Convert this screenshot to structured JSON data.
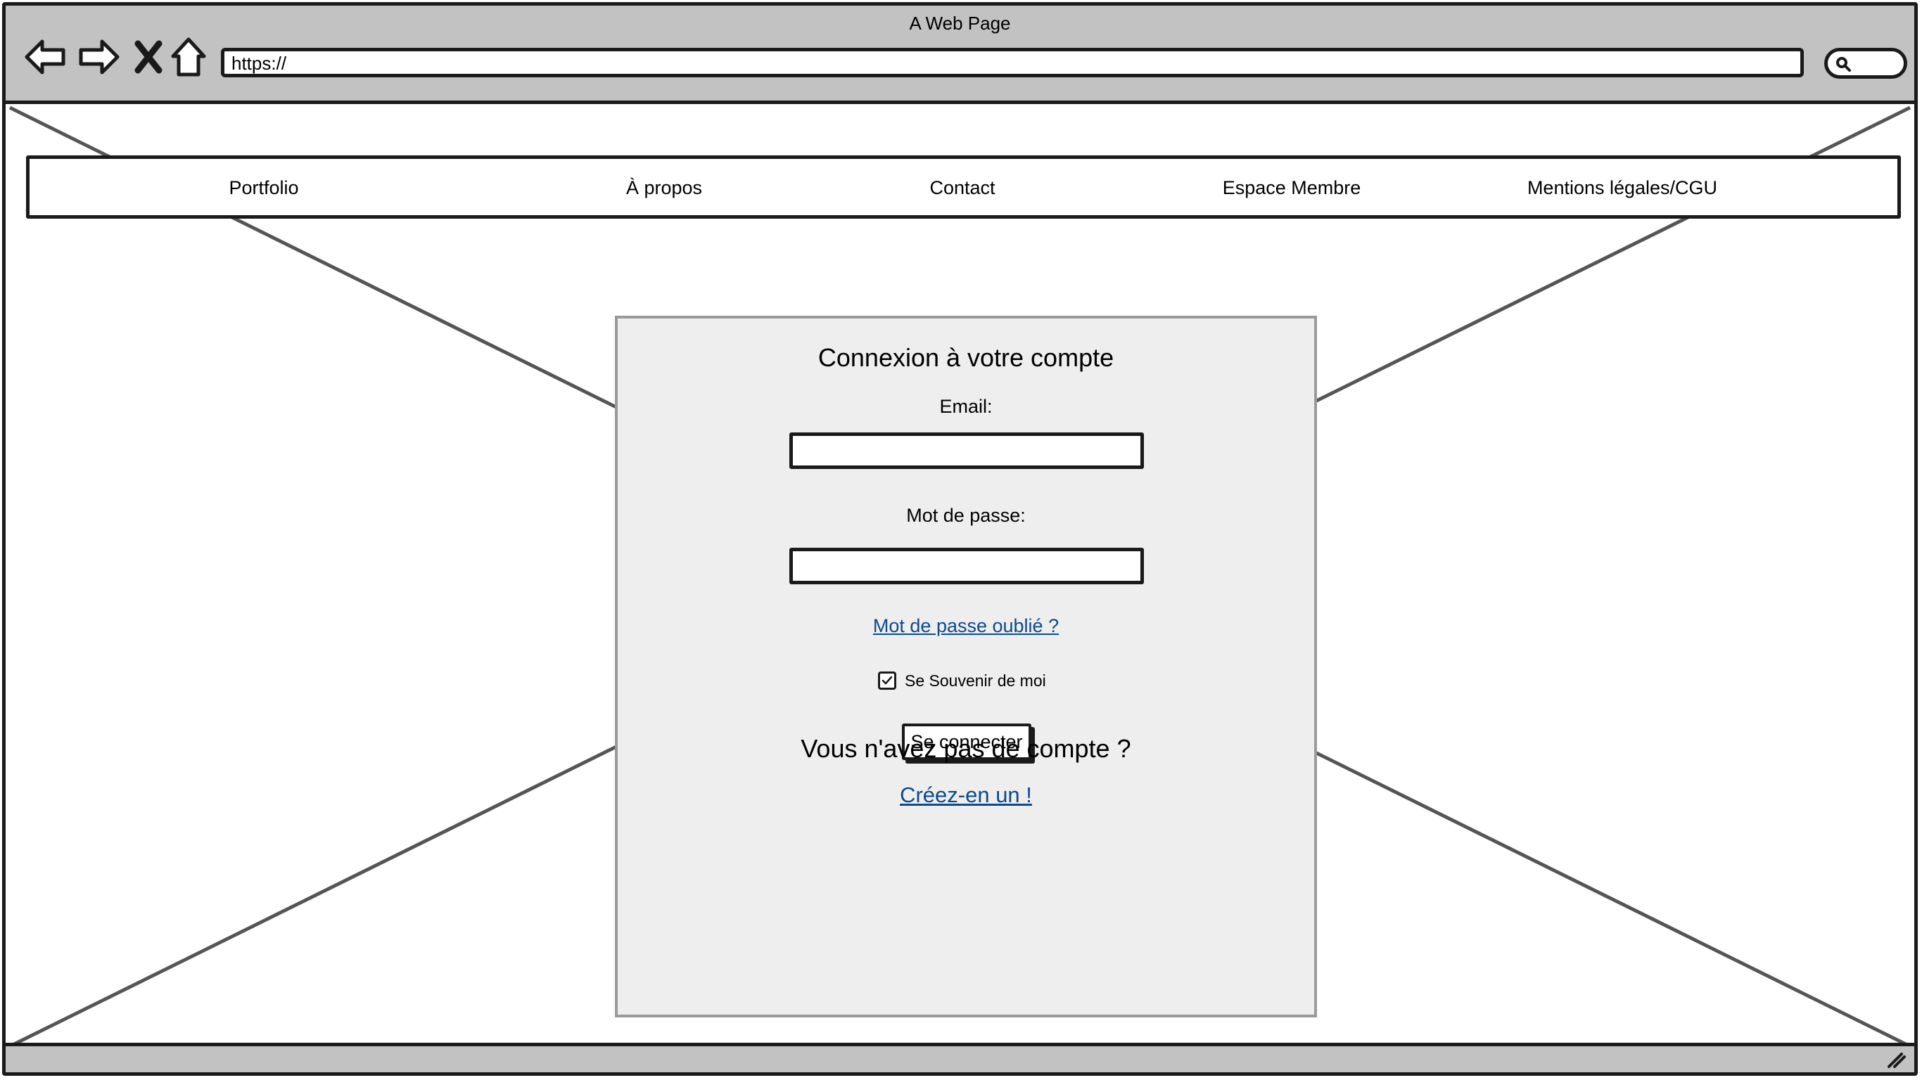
{
  "window": {
    "title": "A Web Page"
  },
  "toolbar": {
    "back_icon": "back-arrow-icon",
    "forward_icon": "forward-arrow-icon",
    "stop_icon": "close-icon",
    "home_icon": "home-icon",
    "url": "https://",
    "search_icon": "search-icon"
  },
  "navbar": {
    "items": [
      {
        "label": "Portfolio"
      },
      {
        "label": "À propos"
      },
      {
        "label": "Contact"
      },
      {
        "label": "Espace Membre"
      },
      {
        "label": "Mentions légales/CGU"
      }
    ]
  },
  "login": {
    "title": "Connexion à votre compte",
    "email_label": "Email:",
    "email_value": "",
    "password_label": "Mot de passe:",
    "password_value": "",
    "forgot_link": "Mot de passe oublié ?",
    "remember_label": "Se Souvenir de moi",
    "remember_checked": true,
    "submit_label": "Se connecter",
    "no_account_text": "Vous n'avez pas de compte ?",
    "create_link": "Créez-en un !"
  },
  "colors": {
    "chrome": "#c2c2c2",
    "panel": "#eeeeee",
    "link": "#0b4a8b",
    "stroke": "#1a1a1a"
  }
}
